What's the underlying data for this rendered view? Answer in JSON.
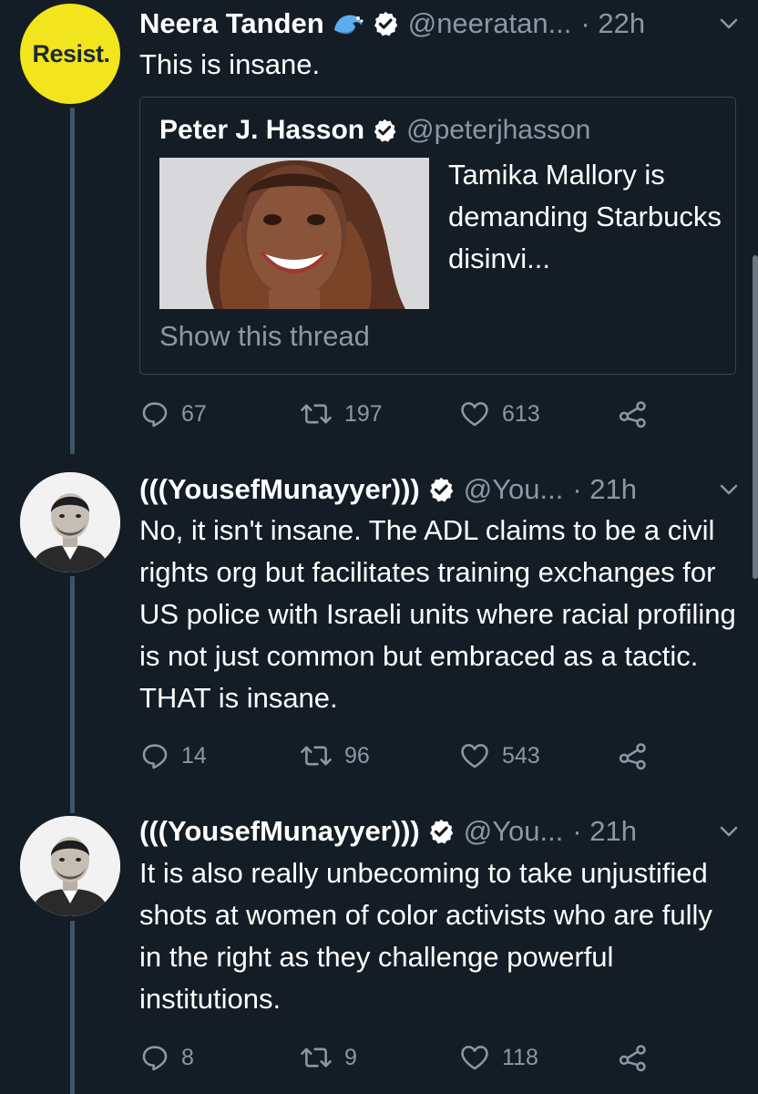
{
  "tweets": [
    {
      "avatar_text": "Resist.",
      "name": "Neera Tanden",
      "handle": "@neeratan...",
      "time": "· 22h",
      "text": "This is insane.",
      "quote": {
        "name": "Peter J. Hasson",
        "handle": "@peterjhasson",
        "text": "Tamika Mallory is demanding Starbucks disinvi...",
        "show_thread": "Show this thread"
      },
      "replies": "67",
      "retweets": "197",
      "likes": "613"
    },
    {
      "name": "(((YousefMunayyer)))",
      "handle": "@You...",
      "time": "· 21h",
      "text": "No, it isn't insane. The ADL claims to be a civil rights org but facilitates training exchanges for US police with Israeli units where racial profiling is not just common but embraced as a tactic. THAT is insane.",
      "replies": "14",
      "retweets": "96",
      "likes": "543"
    },
    {
      "name": "(((YousefMunayyer)))",
      "handle": "@You...",
      "time": "· 21h",
      "text": "It is also really unbecoming to take unjustified shots at women of color activists who are fully in the right as they challenge powerful institutions.",
      "replies": "8",
      "retweets": "9",
      "likes": "118"
    }
  ],
  "icons": {
    "reply": "reply-icon",
    "retweet": "retweet-icon",
    "like": "heart-icon",
    "share": "share-icon",
    "verified": "verified-badge-icon",
    "wave": "wave-emoji-icon",
    "menu": "chevron-down-icon"
  },
  "colors": {
    "background": "#141d26",
    "secondary_text": "#8899a6",
    "thread_line": "#3d5466",
    "avatar_yellow": "#f2e41d"
  }
}
